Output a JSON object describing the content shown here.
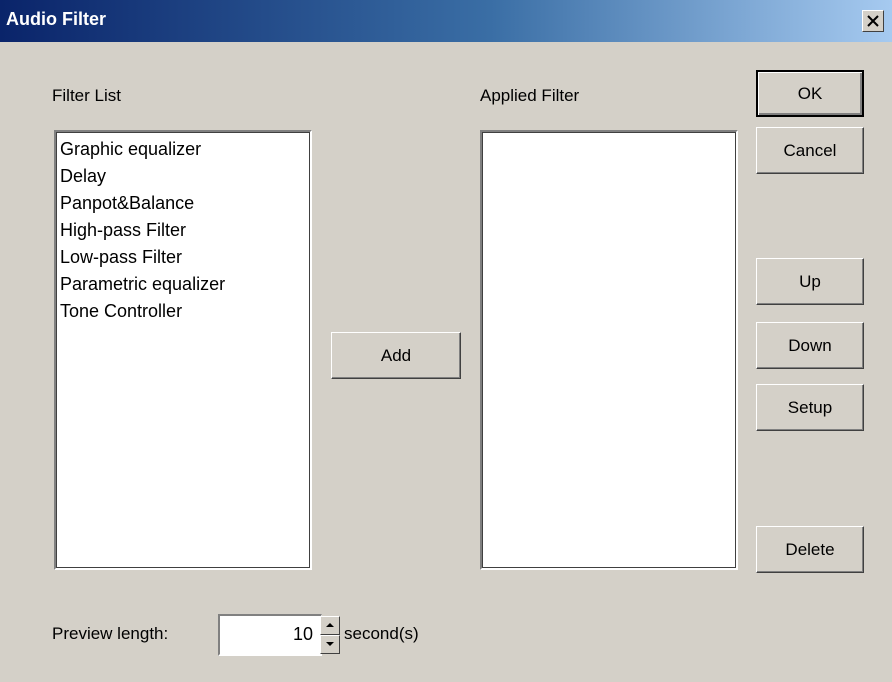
{
  "window": {
    "title": "Audio Filter",
    "close_icon": "close-icon"
  },
  "filter_list": {
    "label": "Filter List",
    "items": [
      "Graphic equalizer",
      "Delay",
      "Panpot&Balance",
      "High-pass Filter",
      "Low-pass Filter",
      "Parametric equalizer",
      "Tone Controller"
    ]
  },
  "applied_filter": {
    "label": "Applied Filter",
    "items": []
  },
  "buttons": {
    "add": "Add",
    "ok": "OK",
    "cancel": "Cancel",
    "up": "Up",
    "down": "Down",
    "setup": "Setup",
    "delete": "Delete"
  },
  "preview": {
    "label": "Preview length:",
    "value": "10",
    "unit": "second(s)"
  },
  "colors": {
    "title_gradient_start": "#0a246a",
    "title_gradient_end": "#a6caf0",
    "dialog_face": "#d4d0c8"
  }
}
